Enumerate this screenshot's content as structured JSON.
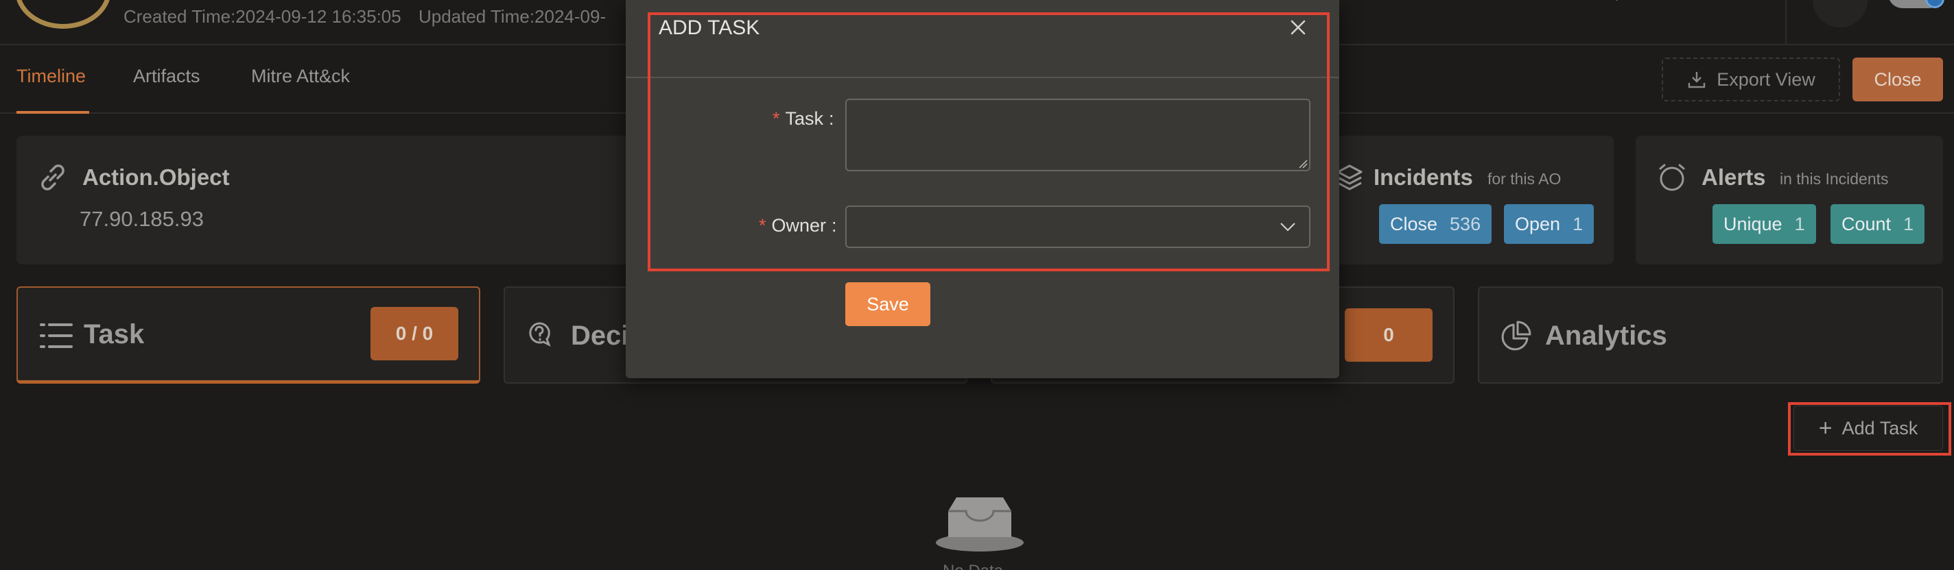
{
  "header": {
    "created_label": "Created Time:2024-09-12 16:35:05",
    "updated_label": "Updated Time:2024-09-"
  },
  "tabs": [
    {
      "label": "Timeline",
      "active": true
    },
    {
      "label": "Artifacts",
      "active": false
    },
    {
      "label": "Mitre Att&ck",
      "active": false
    }
  ],
  "toolbar": {
    "export_label": "Export View",
    "close_label": "Close"
  },
  "action_object": {
    "title": "Action.Object",
    "value": "77.90.185.93"
  },
  "incidents": {
    "title": "Incidents",
    "subtitle": "for this AO",
    "close_label": "Close",
    "close_count": "536",
    "open_label": "Open",
    "open_count": "1"
  },
  "alerts": {
    "title": "Alerts",
    "subtitle": "in this Incidents",
    "unique_label": "Unique",
    "unique_count": "1",
    "count_label": "Count",
    "count_count": "1"
  },
  "panels": {
    "task_title": "Task",
    "task_count": "0 / 0",
    "decision_title": "Deci",
    "third_count": "0",
    "analytics_title": "Analytics"
  },
  "actions": {
    "add_task_label": "Add Task"
  },
  "empty": {
    "text": "No Data"
  },
  "modal": {
    "title": "ADD TASK",
    "task_label": "Task",
    "task_value": "",
    "owner_label": "Owner",
    "owner_value": "",
    "save_label": "Save",
    "required_mark": "*",
    "colon": ":"
  },
  "colors": {
    "accent": "#d0773c",
    "highlight": "#e04333",
    "pill_blue": "#3f7fa8",
    "pill_teal": "#3d8c87"
  }
}
